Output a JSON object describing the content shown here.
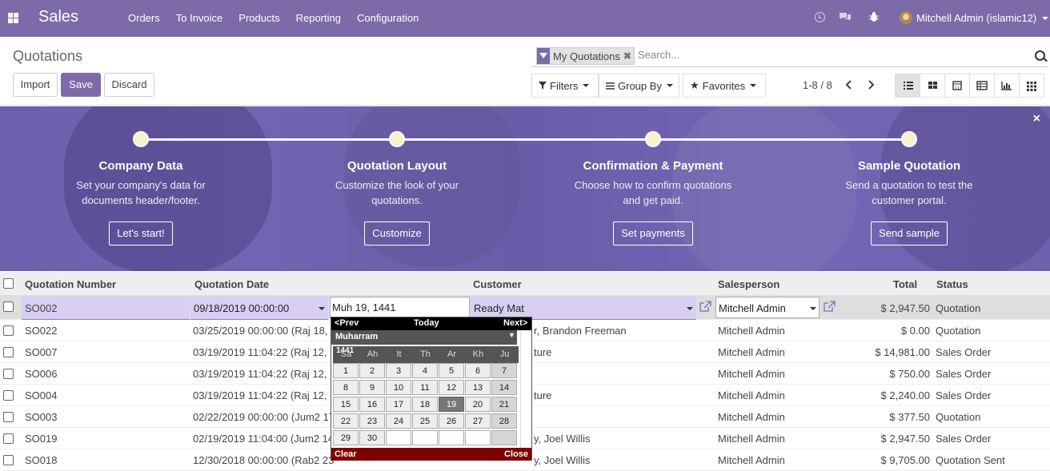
{
  "topbar": {
    "app": "Sales",
    "menu": [
      "Orders",
      "To Invoice",
      "Products",
      "Reporting",
      "Configuration"
    ],
    "user": "Mitchell Admin (islamic12)"
  },
  "control_panel": {
    "title": "Quotations",
    "import": "Import",
    "save": "Save",
    "discard": "Discard",
    "facet": "My Quotations",
    "search_placeholder": "Search...",
    "filters": "Filters",
    "group_by": "Group By",
    "favorites": "Favorites",
    "pager": "1-8 / 8"
  },
  "banner": {
    "steps": [
      {
        "title": "Company Data",
        "desc1": "Set your company's data for",
        "desc2": "documents header/footer.",
        "button": "Let's start!"
      },
      {
        "title": "Quotation Layout",
        "desc1": "Customize the look of your",
        "desc2": "quotations.",
        "button": "Customize"
      },
      {
        "title": "Confirmation & Payment",
        "desc1": "Choose how to confirm quotations",
        "desc2": "and get paid.",
        "button": "Set payments"
      },
      {
        "title": "Sample Quotation",
        "desc1": "Send a quotation to test the",
        "desc2": "customer portal.",
        "button": "Send sample"
      }
    ],
    "close": "×"
  },
  "list": {
    "headers": {
      "number": "Quotation Number",
      "date": "Quotation Date",
      "customer": "Customer",
      "salesperson": "Salesperson",
      "total": "Total",
      "status": "Status"
    },
    "edit_row": {
      "number": "SO002",
      "date": "09/18/2019 00:00:00",
      "hijri_input": "Muh 19, 1441",
      "customer": "Ready Mat",
      "salesperson": "Mitchell Admin",
      "total": "$ 2,947.50",
      "status": "Quotation"
    },
    "rows": [
      {
        "number": "SO022",
        "date": "03/25/2019 00:00:00 (Raj 18,",
        "customer": "r, Brandon Freeman",
        "salesperson": "Mitchell Admin",
        "total": "$ 0.00",
        "status": "Quotation"
      },
      {
        "number": "SO007",
        "date": "03/19/2019 11:04:22 (Raj 12,",
        "customer": "ture",
        "salesperson": "Mitchell Admin",
        "total": "$ 14,981.00",
        "status": "Sales Order"
      },
      {
        "number": "SO006",
        "date": "03/19/2019 11:04:22 (Raj 12,",
        "customer": "",
        "salesperson": "Mitchell Admin",
        "total": "$ 750.00",
        "status": "Sales Order"
      },
      {
        "number": "SO004",
        "date": "03/19/2019 11:04:22 (Raj 12,",
        "customer": "ture",
        "salesperson": "Mitchell Admin",
        "total": "$ 2,240.00",
        "status": "Sales Order"
      },
      {
        "number": "SO003",
        "date": "02/22/2019 00:00:00 (Jum2 17",
        "customer": "",
        "salesperson": "Mitchell Admin",
        "total": "$ 377.50",
        "status": "Quotation"
      },
      {
        "number": "SO019",
        "date": "02/19/2019 11:04:00 (Jum2 14",
        "customer": "y, Joel Willis",
        "salesperson": "Mitchell Admin",
        "total": "$ 2,947.50",
        "status": "Sales Order"
      },
      {
        "number": "SO018",
        "date": "12/30/2018 00:00:00 (Rab2 23",
        "customer": "y, Joel Willis",
        "salesperson": "Mitchell Admin",
        "total": "$ 9,705.00",
        "status": "Quotation Sent"
      }
    ]
  },
  "datepicker": {
    "prev": "<Prev",
    "today": "Today",
    "next": "Next>",
    "month": "Muharram",
    "year": "1441",
    "days": [
      "Sa",
      "Ah",
      "It",
      "Th",
      "Ar",
      "Kh",
      "Ju"
    ],
    "dates": [
      "1",
      "2",
      "3",
      "4",
      "5",
      "6",
      "7",
      "8",
      "9",
      "10",
      "11",
      "12",
      "13",
      "14",
      "15",
      "16",
      "17",
      "18",
      "19",
      "20",
      "21",
      "22",
      "23",
      "24",
      "25",
      "26",
      "27",
      "28",
      "29",
      "30"
    ],
    "selected": "19",
    "clear": "Clear",
    "close": "Close"
  }
}
